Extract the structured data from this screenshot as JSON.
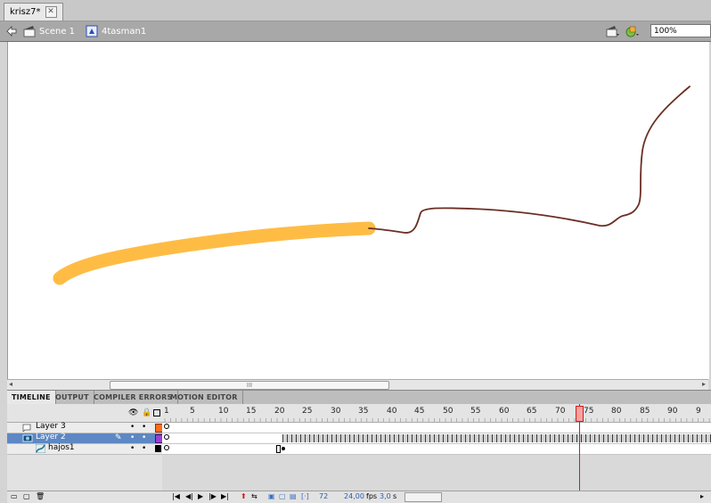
{
  "document_tab": {
    "title": "krisz7*",
    "close": "✕"
  },
  "edit_bar": {
    "scene_label": "Scene 1",
    "symbol_label": "4tasman1",
    "zoom_value": "100%"
  },
  "stage": {
    "background": "#ffffff",
    "yellow_stroke_color": "#ffbc45",
    "line_color": "#6b2e24"
  },
  "scrollbar": {
    "thumb_grip": "III",
    "left_arrow": "◂",
    "right_arrow": "▸"
  },
  "panel_tabs": [
    "TIMELINE",
    "OUTPUT",
    "COMPILER ERRORS",
    "MOTION EDITOR"
  ],
  "timeline": {
    "frame_numbers": [
      "1",
      "5",
      "10",
      "15",
      "20",
      "25",
      "30",
      "35",
      "40",
      "45",
      "50",
      "55",
      "60",
      "65",
      "70",
      "75",
      "80",
      "85",
      "90",
      "9"
    ],
    "current_frame": "72",
    "fps": "24,00",
    "fps_unit": "fps",
    "time": "3,0",
    "time_unit": "s",
    "layers": [
      {
        "name": "Layer 3",
        "color": "#ff6b1a",
        "selected": false,
        "icon": "layer-icon"
      },
      {
        "name": "Layer 2",
        "color": "#9b3fd1",
        "selected": true,
        "icon": "layer-icon"
      },
      {
        "name": "hajos1",
        "color": "#000000",
        "selected": false,
        "icon": "motion-guide-icon"
      }
    ]
  }
}
